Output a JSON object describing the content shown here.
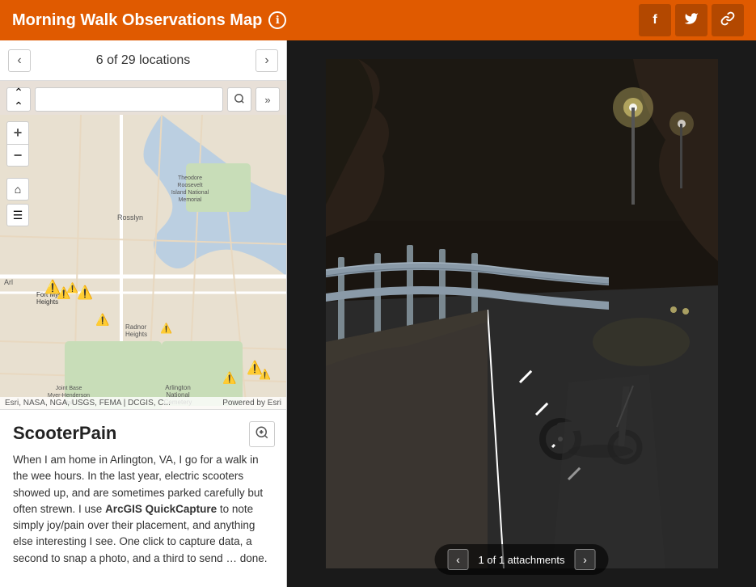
{
  "header": {
    "title": "Morning Walk Observations Map",
    "info_icon": "ℹ",
    "facebook_label": "f",
    "twitter_label": "🐦",
    "link_label": "🔗"
  },
  "nav": {
    "prev_label": "‹",
    "next_label": "›",
    "location_text": "6 of 29 locations"
  },
  "map": {
    "search_placeholder": "",
    "collapse_icon": "⌃⌃",
    "search_icon": "🔍",
    "expand_icon": "»",
    "zoom_in": "+",
    "zoom_out": "−",
    "home_icon": "⌂",
    "list_icon": "☰",
    "attribution_left": "Esri, NASA, NGA, USGS, FEMA | DCGIS, C...",
    "attribution_right": "Powered by Esri"
  },
  "info": {
    "title": "ScooterPain",
    "zoom_icon": "⊕",
    "description_part1": "When I am home in Arlington, VA, I go for a walk in the wee hours. In the last year, electric scooters showed up, and are sometimes parked carefully but often strewn. I use ",
    "description_highlight": "ArcGIS QuickCapture",
    "description_part2": " to note simply joy/pain over their placement, and anything else interesting I see. One click to capture data, a second to snap a photo, and a third to send … done."
  },
  "attachment": {
    "prev_label": "‹",
    "next_label": "›",
    "label": "1 of 1 attachments"
  },
  "colors": {
    "header_bg": "#e05a00",
    "accent": "#e05a00"
  }
}
